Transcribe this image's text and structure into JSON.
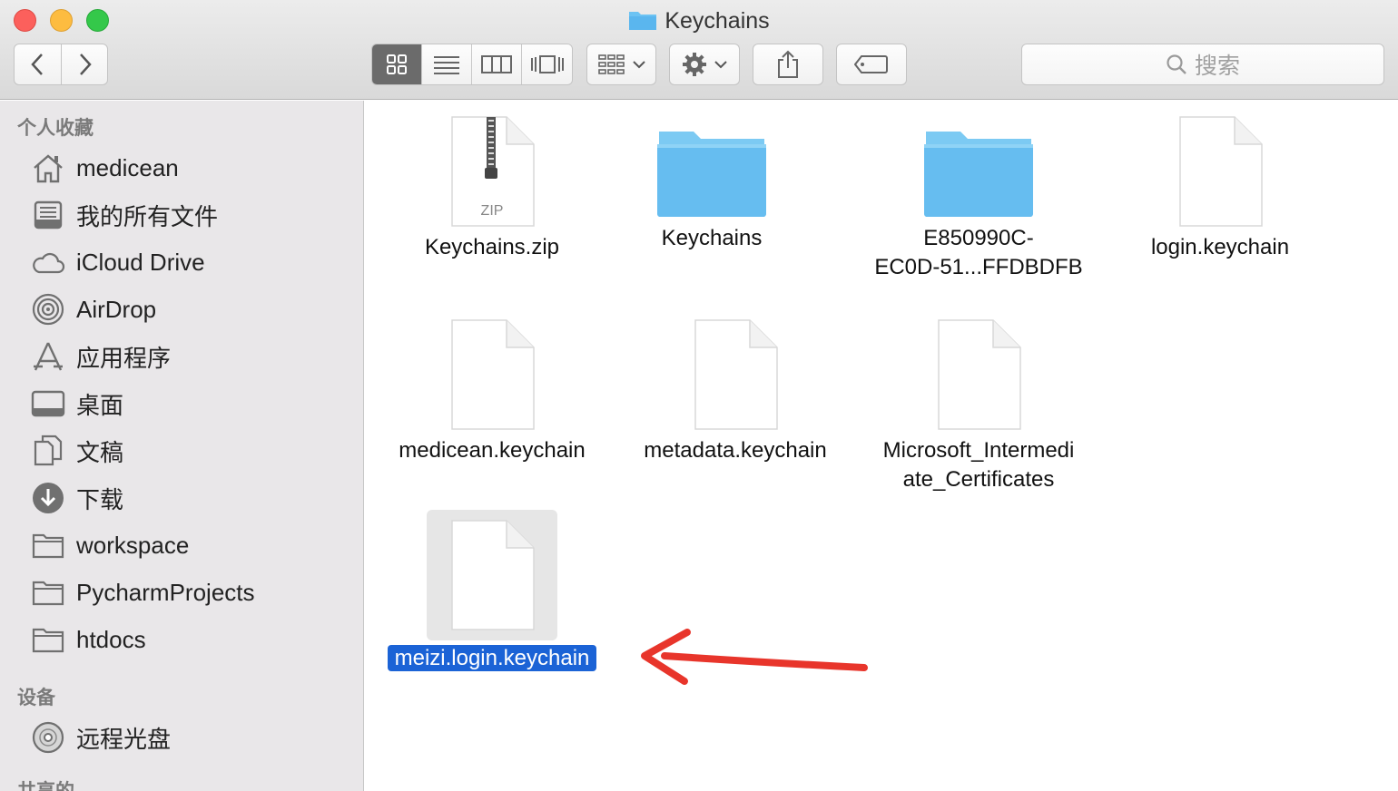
{
  "window": {
    "title": "Keychains"
  },
  "toolbar": {
    "search_placeholder": "搜索"
  },
  "sidebar": {
    "favorites_title": "个人收藏",
    "items": [
      {
        "label": "medicean",
        "icon": "home-icon"
      },
      {
        "label": "我的所有文件",
        "icon": "all-files-icon"
      },
      {
        "label": "iCloud Drive",
        "icon": "cloud-icon"
      },
      {
        "label": "AirDrop",
        "icon": "airdrop-icon"
      },
      {
        "label": "应用程序",
        "icon": "applications-icon"
      },
      {
        "label": "桌面",
        "icon": "desktop-icon"
      },
      {
        "label": "文稿",
        "icon": "documents-icon"
      },
      {
        "label": "下载",
        "icon": "downloads-icon"
      },
      {
        "label": "workspace",
        "icon": "folder-icon"
      },
      {
        "label": "PycharmProjects",
        "icon": "folder-icon"
      },
      {
        "label": "htdocs",
        "icon": "folder-icon"
      }
    ],
    "devices_title": "设备",
    "devices": [
      {
        "label": "远程光盘",
        "icon": "disc-icon"
      }
    ],
    "shared_title": "共享的"
  },
  "files": [
    {
      "name": "Keychains.zip",
      "kind": "zip",
      "zip_label": "ZIP"
    },
    {
      "name": "Keychains",
      "kind": "folder"
    },
    {
      "name_line1": "E850990C-",
      "name_line2": "EC0D-51...FFDBDFB",
      "kind": "folder"
    },
    {
      "name": "login.keychain",
      "kind": "document"
    },
    {
      "name": "medicean.keychain",
      "kind": "document"
    },
    {
      "name": "metadata.keychain",
      "kind": "document"
    },
    {
      "name_line1": "Microsoft_Intermedi",
      "name_line2": "ate_Certificates",
      "kind": "document"
    },
    {
      "name": "meizi.login.keychain",
      "kind": "document",
      "selected": true
    }
  ],
  "colors": {
    "selection": "#1b63d6",
    "folder": "#5ab8ef",
    "annotation_arrow": "#e8352b"
  }
}
